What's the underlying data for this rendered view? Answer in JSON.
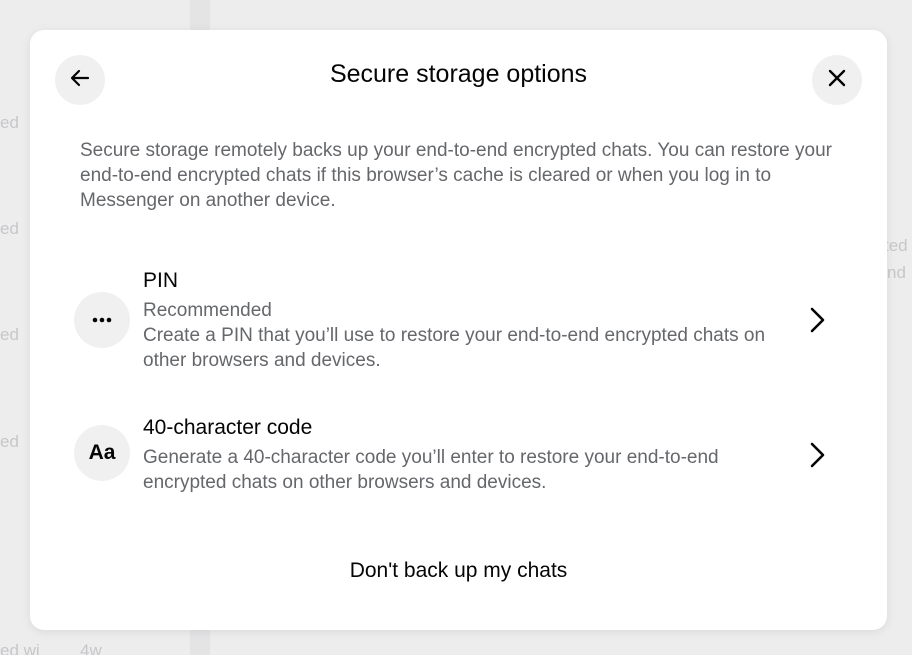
{
  "background": {
    "fragments": [
      "ed",
      "ed",
      "ed",
      "ed",
      "ed wi",
      "4w",
      "ted",
      "nd"
    ]
  },
  "modal": {
    "title": "Secure storage options",
    "description": "Secure storage remotely backs up your end-to-end encrypted chats. You can restore your end-to-end encrypted chats if this browser’s cache is cleared or when you log in to Messenger on another device.",
    "back_icon": "arrow-left-icon",
    "close_icon": "close-icon",
    "options": [
      {
        "icon": "more-dots-icon",
        "title": "PIN",
        "subtitle": "Recommended",
        "detail": "Create a PIN that you’ll use to restore your end-to-end encrypted chats on other browsers and devices."
      },
      {
        "icon": "text-aa-icon",
        "icon_text": "Aa",
        "title": "40-character code",
        "detail": "Generate a 40-character code you’ll enter to restore your end-to-end encrypted chats on other browsers and devices."
      }
    ],
    "footer_button": "Don't back up my chats"
  }
}
